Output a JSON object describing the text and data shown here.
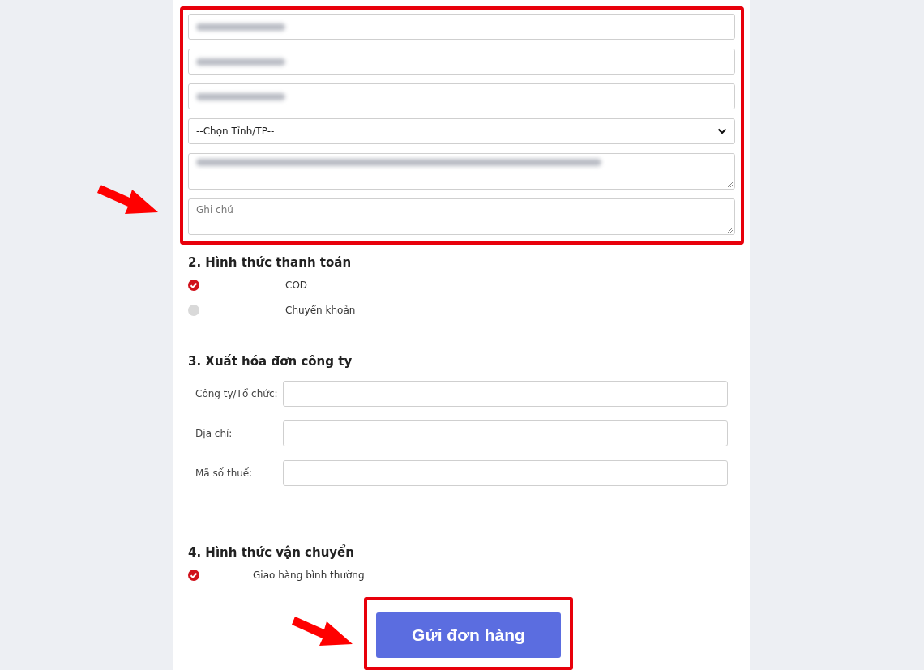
{
  "contact_fields": [
    {
      "kind": "input",
      "redacted": true
    },
    {
      "kind": "input",
      "redacted": true
    },
    {
      "kind": "input",
      "redacted": true
    },
    {
      "kind": "select",
      "value": "--Chọn Tỉnh/TP--"
    },
    {
      "kind": "textarea",
      "redacted": true
    },
    {
      "kind": "textarea",
      "placeholder": "Ghi chú"
    }
  ],
  "payment": {
    "title": "2. Hình thức thanh toán",
    "options": [
      {
        "label": "COD",
        "selected": true
      },
      {
        "label": "Chuyển khoản",
        "selected": false
      }
    ]
  },
  "invoice": {
    "title": "3. Xuất hóa đơn công ty",
    "fields": [
      {
        "label": "Công ty/Tổ chức:"
      },
      {
        "label": "Địa chỉ:"
      },
      {
        "label": "Mã số thuế:"
      }
    ]
  },
  "shipping": {
    "title": "4. Hình thức vận chuyển",
    "options": [
      {
        "label": "Giao hàng bình thường",
        "selected": true
      }
    ]
  },
  "submit": {
    "label": "Gửi đơn hàng"
  }
}
